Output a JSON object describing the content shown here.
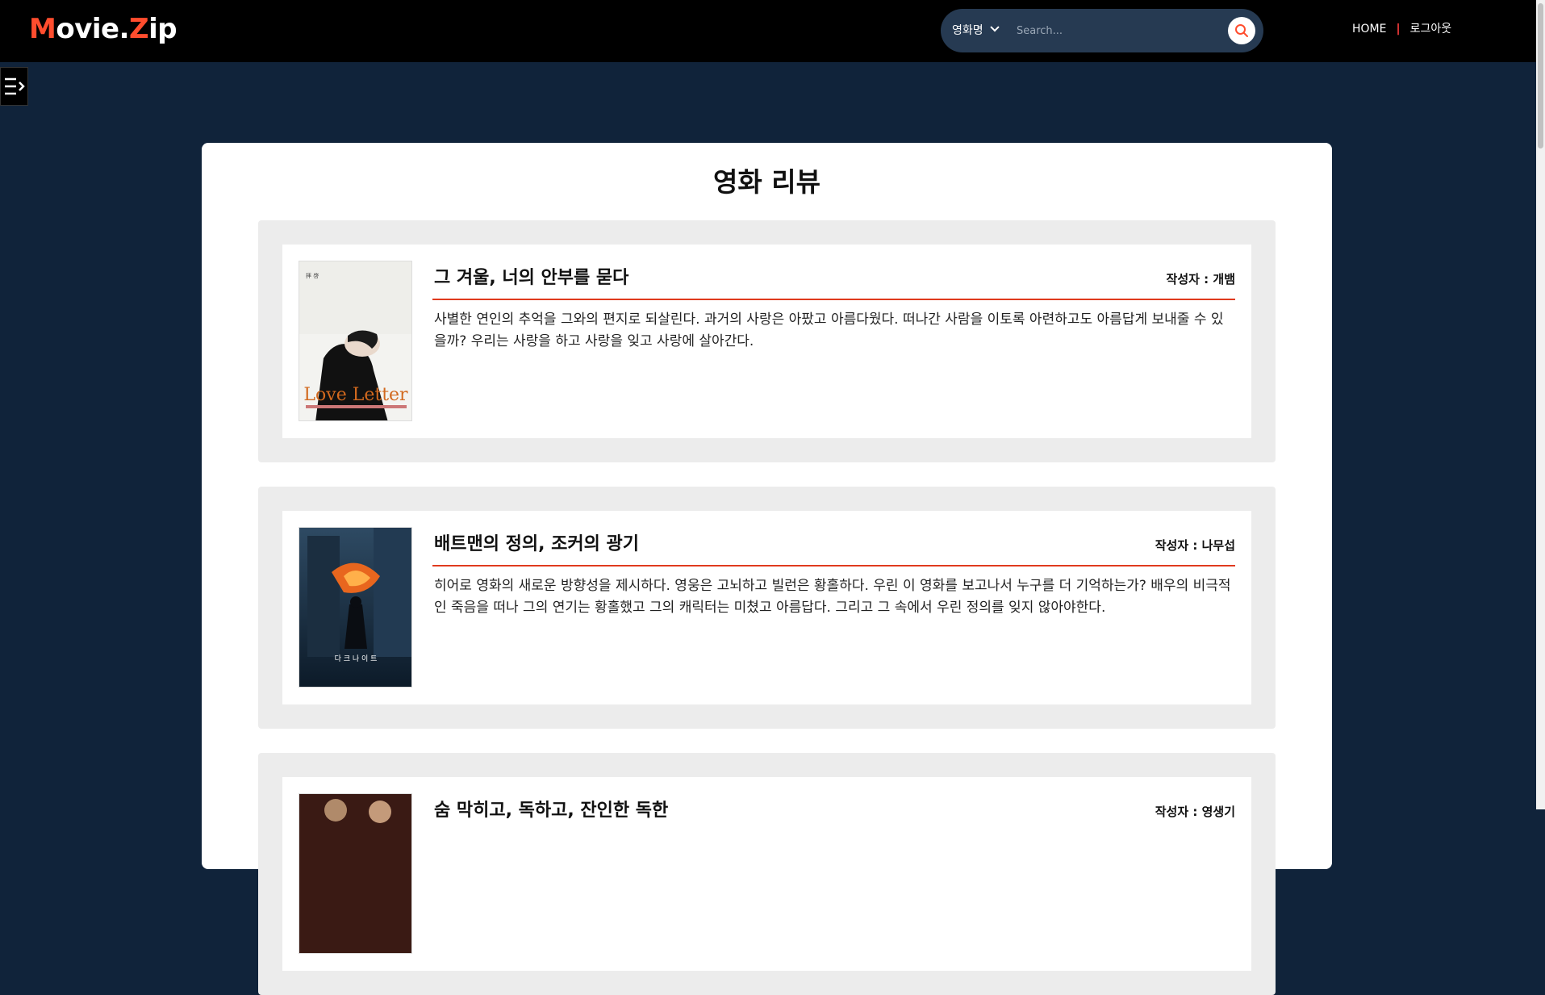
{
  "header": {
    "logo": "Movie.Zip",
    "search": {
      "selected_option": "영화명",
      "placeholder": "Search..."
    },
    "nav": {
      "home": "HOME",
      "separator": "|",
      "logout": "로그아웃"
    }
  },
  "main": {
    "title": "영화 리뷰",
    "reviews": [
      {
        "title": "그 겨울, 너의 안부를 묻다",
        "author": "작성자 : 개뱀",
        "body": "사별한 연인의 추억을 그와의 편지로 되살린다. 과거의 사랑은 아팠고 아름다웠다. 떠나간 사람을 이토록 아련하고도 아름답게 보내줄 수 있을까? 우리는 사랑을 하고 사랑을 잊고 사랑에 살아간다.",
        "poster_text": "Love Letter"
      },
      {
        "title": "배트맨의 정의, 조커의 광기",
        "author": "작성자 : 나무섭",
        "body": "히어로 영화의 새로운 방향성을 제시하다. 영웅은 고뇌하고 빌런은 황홀하다. 우린 이 영화를 보고나서 누구를 더 기억하는가? 배우의 비극적인 죽음을 떠나 그의 연기는 황홀했고 그의 캐릭터는 미쳤고 아름답다. 그리고 그 속에서 우린 정의를 잊지 않아야한다.",
        "poster_text": "다 크 나 이 트"
      },
      {
        "title": "숨 막히고, 독하고, 잔인한 독한",
        "author": "작성자 : 영생기"
      }
    ]
  },
  "colors": {
    "accent": "#ff4d2e",
    "header_bg": "#000000",
    "page_bg": "#10233a",
    "divider": "#e03a1e"
  }
}
